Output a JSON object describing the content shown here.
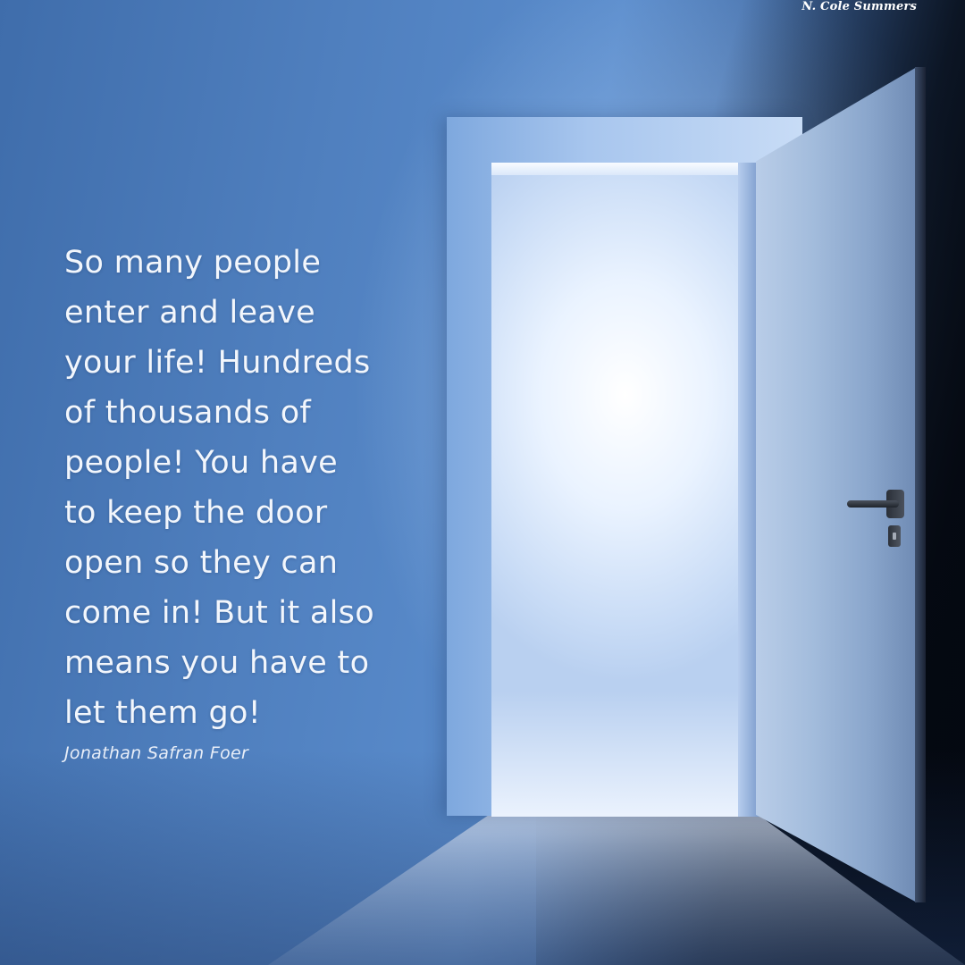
{
  "quote": {
    "text": "So many people\nenter and leave\nyour life! Hundreds\nof thousands of\npeople! You have\nto keep the door\nopen so they can\ncome in! But it also\nmeans you have to\nlet them go!",
    "author": "Jonathan Safran Foer"
  },
  "watermark": {
    "text": "N. Cole Summers"
  },
  "scene": {
    "description_icons": [
      "open-door-icon",
      "door-handle-icon"
    ],
    "colors": {
      "background_blue": "#4f7fbe",
      "light": "#ffffff",
      "shadow": "#0f1a2c",
      "text": "#f2f6fc"
    }
  }
}
